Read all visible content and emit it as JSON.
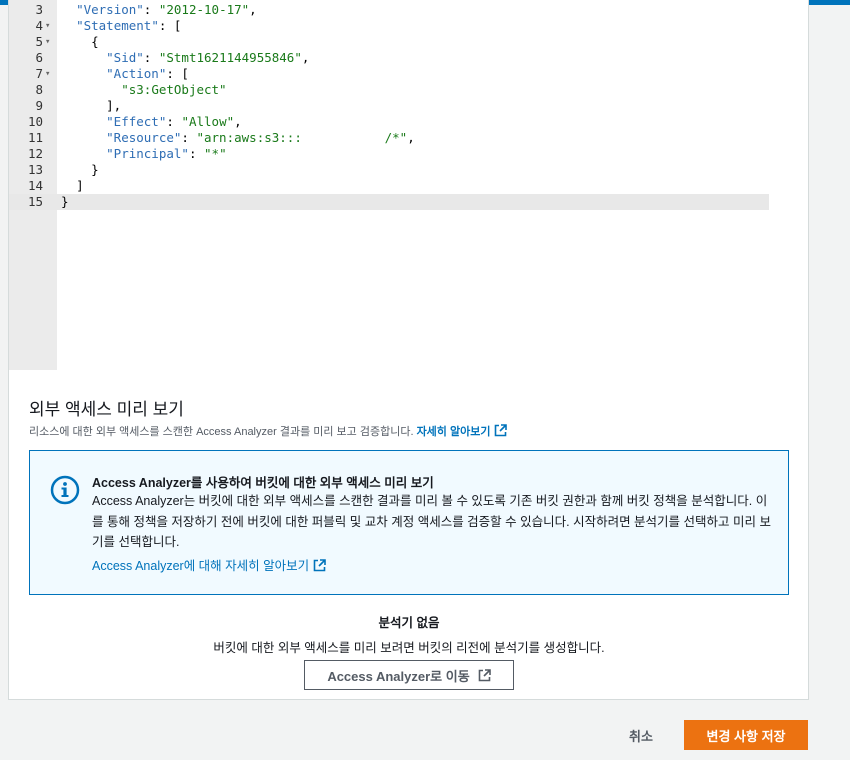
{
  "editor": {
    "lines": [
      {
        "n": "3",
        "fold": "",
        "indent": "  ",
        "parts": [
          [
            "k",
            "\"Version\""
          ],
          [
            "p",
            ": "
          ],
          [
            "s",
            "\"2012-10-17\""
          ],
          [
            "p",
            ","
          ]
        ]
      },
      {
        "n": "4",
        "fold": "▾",
        "indent": "  ",
        "parts": [
          [
            "k",
            "\"Statement\""
          ],
          [
            "p",
            ": ["
          ]
        ]
      },
      {
        "n": "5",
        "fold": "▾",
        "indent": "    ",
        "parts": [
          [
            "p",
            "{"
          ]
        ]
      },
      {
        "n": "6",
        "fold": "",
        "indent": "      ",
        "parts": [
          [
            "k",
            "\"Sid\""
          ],
          [
            "p",
            ": "
          ],
          [
            "s",
            "\"Stmt1621144955846\""
          ],
          [
            "p",
            ","
          ]
        ]
      },
      {
        "n": "7",
        "fold": "▾",
        "indent": "      ",
        "parts": [
          [
            "k",
            "\"Action\""
          ],
          [
            "p",
            ": ["
          ]
        ]
      },
      {
        "n": "8",
        "fold": "",
        "indent": "        ",
        "parts": [
          [
            "s",
            "\"s3:GetObject\""
          ]
        ]
      },
      {
        "n": "9",
        "fold": "",
        "indent": "      ",
        "parts": [
          [
            "p",
            "],"
          ]
        ]
      },
      {
        "n": "10",
        "fold": "",
        "indent": "      ",
        "parts": [
          [
            "k",
            "\"Effect\""
          ],
          [
            "p",
            ": "
          ],
          [
            "s",
            "\"Allow\""
          ],
          [
            "p",
            ","
          ]
        ]
      },
      {
        "n": "11",
        "fold": "",
        "indent": "      ",
        "parts": [
          [
            "k",
            "\"Resource\""
          ],
          [
            "p",
            ": "
          ],
          [
            "s",
            "\"arn:aws:s3:::           /*\""
          ],
          [
            "p",
            ","
          ]
        ]
      },
      {
        "n": "12",
        "fold": "",
        "indent": "      ",
        "parts": [
          [
            "k",
            "\"Principal\""
          ],
          [
            "p",
            ": "
          ],
          [
            "s",
            "\"*\""
          ]
        ]
      },
      {
        "n": "13",
        "fold": "",
        "indent": "    ",
        "parts": [
          [
            "p",
            "}"
          ]
        ]
      },
      {
        "n": "14",
        "fold": "",
        "indent": "  ",
        "parts": [
          [
            "p",
            "]"
          ]
        ]
      },
      {
        "n": "15",
        "fold": "",
        "indent": "",
        "parts": [
          [
            "p",
            "}"
          ]
        ]
      }
    ],
    "active_line": "15"
  },
  "preview": {
    "title": "외부 액세스 미리 보기",
    "description": "리소스에 대한 외부 액세스를 스캔한 Access Analyzer 결과를 미리 보고 검증합니다.",
    "learn_more": "자세히 알아보기"
  },
  "info_box": {
    "icon": "info-icon",
    "title": "Access Analyzer를 사용하여 버킷에 대한 외부 액세스 미리 보기",
    "body": "Access Analyzer는 버킷에 대한 외부 액세스를 스캔한 결과를 미리 볼 수 있도록 기존 버킷 권한과 함께 버킷 정책을 분석합니다. 이를 통해 정책을 저장하기 전에 버킷에 대한 퍼블릭 및 교차 계정 액세스를 검증할 수 있습니다. 시작하려면 분석기를 선택하고 미리 보기를 선택합니다.",
    "link": "Access Analyzer에 대해 자세히 알아보기"
  },
  "empty_state": {
    "title": "분석기 없음",
    "description": "버킷에 대한 외부 액세스를 미리 보려면 버킷의 리전에 분석기를 생성합니다.",
    "button": "Access Analyzer로 이동"
  },
  "footer": {
    "cancel": "취소",
    "save": "변경 사항 저장"
  },
  "colors": {
    "accent": "#0073bb",
    "primary_button": "#ec7211",
    "info_bg": "#f1faff"
  }
}
